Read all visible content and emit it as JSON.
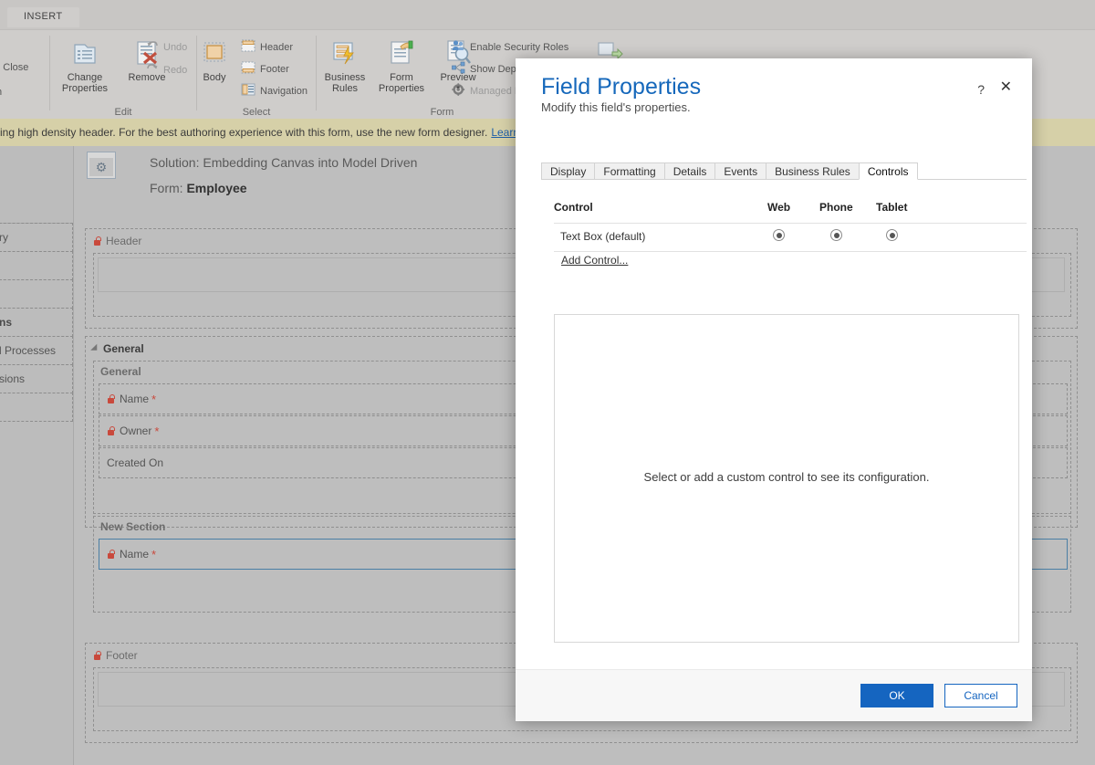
{
  "ribbon": {
    "tab_label": "INSERT",
    "clipped_left": [
      "s",
      "nd Close",
      "h"
    ],
    "groups": [
      {
        "name": "Edit",
        "label": "Edit",
        "big_buttons": [
          {
            "label": "Change Properties",
            "icon": "change-properties-icon"
          },
          {
            "label": "Remove",
            "icon": "remove-icon"
          }
        ],
        "small_buttons": [
          {
            "label": "Undo",
            "icon": "undo-icon",
            "disabled": true
          },
          {
            "label": "Redo",
            "icon": "redo-icon",
            "disabled": true
          }
        ]
      },
      {
        "name": "Select",
        "label": "Select",
        "big_buttons": [
          {
            "label": "Body",
            "icon": "body-icon"
          }
        ],
        "small_buttons": [
          {
            "label": "Header",
            "icon": "header-icon",
            "disabled": false
          },
          {
            "label": "Footer",
            "icon": "footer-icon",
            "disabled": false
          },
          {
            "label": "Navigation",
            "icon": "navigation-icon",
            "disabled": false
          }
        ]
      },
      {
        "name": "Form",
        "label": "Form",
        "big_buttons": [
          {
            "label": "Business Rules",
            "icon": "business-rules-icon"
          },
          {
            "label": "Form Properties",
            "icon": "form-properties-icon"
          },
          {
            "label": "Preview",
            "icon": "preview-icon"
          }
        ],
        "small_buttons": [
          {
            "label": "Enable Security Roles",
            "icon": "security-roles-icon",
            "disabled": false
          },
          {
            "label": "Show Dependencies",
            "icon": "show-dependencies-icon",
            "disabled": false
          },
          {
            "label": "Managed Properties",
            "icon": "managed-properties-icon",
            "disabled": true
          }
        ]
      }
    ]
  },
  "notification": {
    "text": "sing high density header. For the best authoring experience with this form, use the new form designer.",
    "link_label": "Learn more"
  },
  "designer": {
    "solution_label": "Solution: Embedding Canvas into Model Driven",
    "form_prefix": "Form:",
    "form_name": "Employee",
    "solution_icon": "solution-gear-icon",
    "left_pane_items": [
      {
        "label": "ry"
      },
      {
        "label": ""
      },
      {
        "label": ""
      },
      {
        "label": "ns",
        "bold": true
      },
      {
        "label": "l Processes"
      },
      {
        "label": "sions"
      }
    ],
    "header_section": {
      "label": "Header",
      "locked": true
    },
    "general_tab": {
      "label": "General"
    },
    "general_section": {
      "label": "General"
    },
    "general_fields": [
      {
        "label": "Name",
        "required": true,
        "locked": true
      },
      {
        "label": "Owner",
        "required": true,
        "locked": true
      },
      {
        "label": "Created On",
        "required": false,
        "locked": false
      }
    ],
    "new_section": {
      "label": "New Section"
    },
    "new_section_fields": [
      {
        "label": "Name",
        "required": true,
        "locked": true,
        "selected": true
      }
    ],
    "footer_section": {
      "label": "Footer",
      "locked": true
    }
  },
  "dialog": {
    "title": "Field Properties",
    "subtitle": "Modify this field's properties.",
    "help_glyph": "?",
    "close_glyph": "✕",
    "tabs": [
      {
        "label": "Display",
        "active": false
      },
      {
        "label": "Formatting",
        "active": false
      },
      {
        "label": "Details",
        "active": false
      },
      {
        "label": "Events",
        "active": false
      },
      {
        "label": "Business Rules",
        "active": false
      },
      {
        "label": "Controls",
        "active": true
      }
    ],
    "controls_table": {
      "columns": [
        "Control",
        "Web",
        "Phone",
        "Tablet"
      ],
      "rows": [
        {
          "name": "Text Box (default)",
          "web": true,
          "phone": true,
          "tablet": true
        }
      ]
    },
    "add_control_label": "Add Control...",
    "config_placeholder": "Select or add a custom control to see its configuration.",
    "buttons": {
      "ok": "OK",
      "cancel": "Cancel"
    }
  },
  "colors": {
    "accent_blue": "#1668bb",
    "button_blue": "#1565c0",
    "notification_bg": "#d6d0a8",
    "ribbon_bg": "#cfcdcb",
    "workspace_bg": "#b9b9b9",
    "required_red": "#c9493c",
    "selection_border": "#4a7fa5"
  }
}
